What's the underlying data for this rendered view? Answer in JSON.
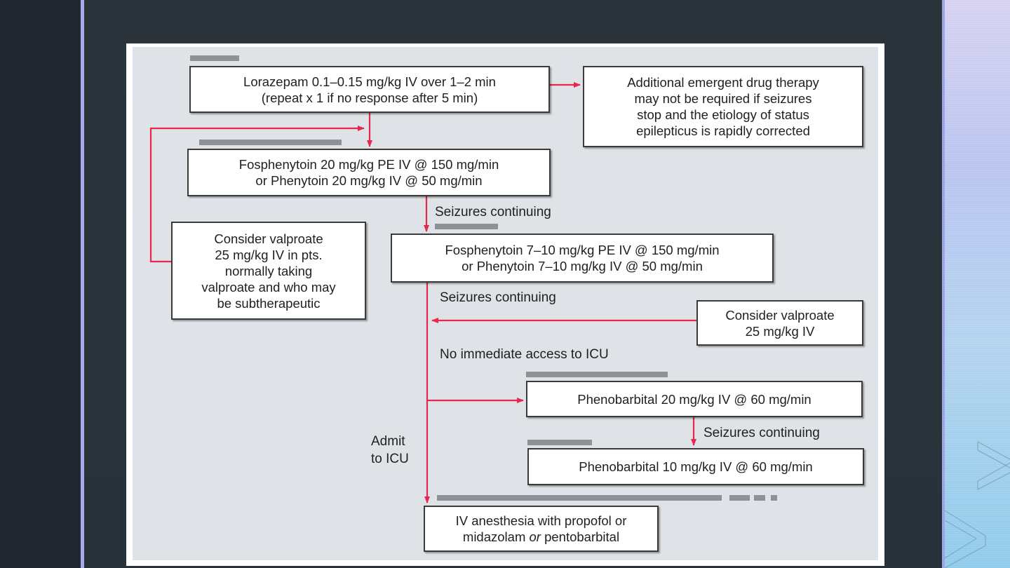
{
  "slide": {
    "colors": {
      "background": "#2b333b",
      "accent_stripe": "#a7a9ec",
      "arrow": "#e8264f",
      "figure_bg": "#dfe3e7",
      "box_border": "#3a3a3a"
    }
  },
  "flowchart": {
    "boxes": {
      "lorazepam": [
        "Lorazepam 0.1–0.15 mg/kg IV over 1–2 min",
        "(repeat x 1 if no response after 5 min)"
      ],
      "additional": [
        "Additional emergent drug therapy",
        "may not be required if seizures",
        "stop and the etiology of status",
        "epilepticus is rapidly corrected"
      ],
      "fosphenytoin20": [
        "Fosphenytoin 20 mg/kg PE IV @ 150 mg/min",
        "or Phenytoin 20 mg/kg IV @ 50 mg/min"
      ],
      "valproate_pts": [
        "Consider valproate",
        "25 mg/kg IV in pts.",
        "normally taking",
        "valproate and who may",
        "be subtherapeutic"
      ],
      "fosphenytoin710": [
        "Fosphenytoin 7–10 mg/kg PE IV @ 150 mg/min",
        "or Phenytoin 7–10 mg/kg IV @ 50 mg/min"
      ],
      "valproate": [
        "Consider valproate",
        "25 mg/kg IV"
      ],
      "phenobarbital20": [
        "Phenobarbital 20 mg/kg IV @ 60 mg/min"
      ],
      "phenobarbital10": [
        "Phenobarbital 10 mg/kg IV @ 60 mg/min"
      ],
      "anesthesia_line1": "IV anesthesia with propofol or",
      "anesthesia_line2_a": "midazolam ",
      "anesthesia_line2_or": "or",
      "anesthesia_line2_b": " pentobarbital"
    },
    "labels": {
      "seizures_continuing_1": "Seizures continuing",
      "seizures_continuing_2": "Seizures continuing",
      "no_icu": "No immediate access to ICU",
      "seizures_continuing_3": "Seizures continuing",
      "admit_icu_1": "Admit",
      "admit_icu_2": "to ICU"
    }
  }
}
